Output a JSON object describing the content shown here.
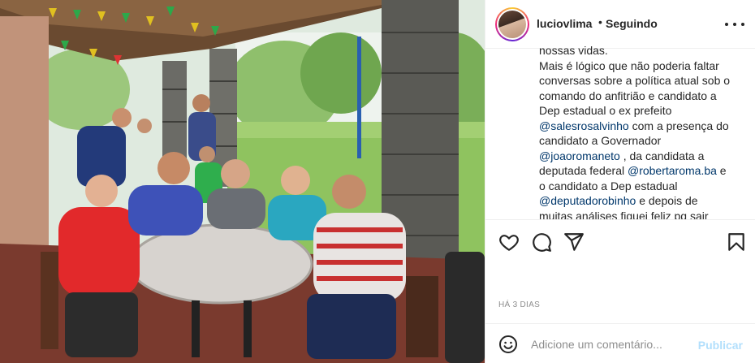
{
  "post": {
    "username": "luciovlima",
    "separator": "•",
    "follow_label": "Seguindo",
    "caption_lines": [
      {
        "text": "nossas vidas.",
        "mention": false
      },
      {
        "text": "Mais é lógico que não poderia faltar",
        "mention": false
      },
      {
        "text": "conversas sobre a política atual sob o",
        "mention": false
      },
      {
        "text": "comando do anfitrião e candidato a",
        "mention": false
      },
      {
        "text": "Dep estadual o ex prefeito",
        "mention": false
      }
    ],
    "caption": {
      "l6_mention": "@salesrosalvinho",
      "l6_rest": " com a presença do",
      "l7": "candidato a Governador",
      "l8_mention": "@joaoromaneto",
      "l8_rest": " , da candidata a",
      "l9_pre": "deputada federal ",
      "l9_mention": "@robertaroma.ba",
      "l9_rest": " e",
      "l10": "o candidato a Dep estadual",
      "l11_mention": "@deputadorobinho",
      "l11_rest": " e depois de",
      "l12": "muitas análises fiquei feliz pq sair"
    },
    "date": "HÁ 3 DIAS",
    "comment_placeholder": "Adicione um comentário...",
    "publish_label": "Publicar"
  },
  "icons": {
    "like": "heart-icon",
    "comment": "comment-icon",
    "share": "share-icon",
    "save": "bookmark-icon",
    "emoji": "emoji-icon",
    "more": "more-options-icon"
  },
  "colors": {
    "mention": "#00376b",
    "publish_disabled": "#b2dffc",
    "muted": "#8e8e8e"
  }
}
